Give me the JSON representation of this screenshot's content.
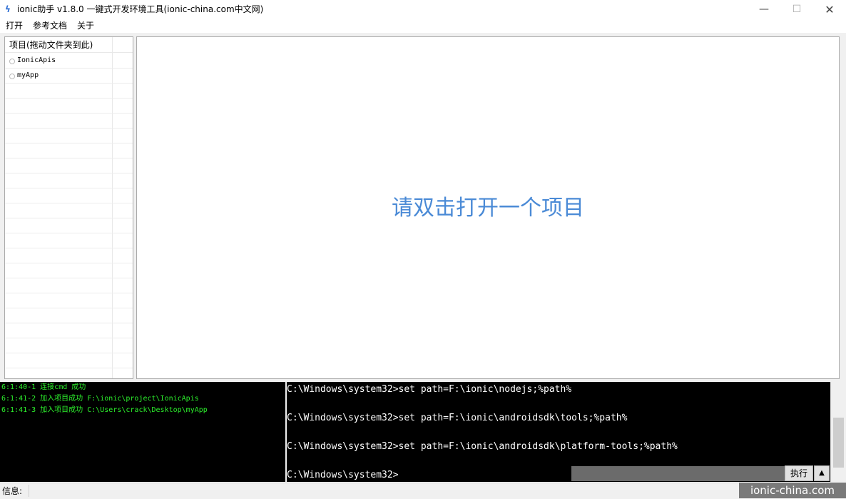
{
  "window": {
    "title": "ionic助手 v1.8.0 一键式开发环境工具(ionic-china.com中文网)",
    "icon": "lightning-icon",
    "controls": {
      "minimize": "—",
      "maximize": "☐",
      "close": "✕"
    }
  },
  "menu": {
    "items": [
      "打开",
      "参考文档",
      "关于"
    ]
  },
  "projects": {
    "header": "项目(拖动文件夹到此)",
    "items": [
      {
        "label": "IonicApis"
      },
      {
        "label": "myApp"
      }
    ]
  },
  "main": {
    "hint": "请双击打开一个项目",
    "hint_color": "#4a8ad6"
  },
  "log": {
    "color": "#2cf02c",
    "lines": [
      "6:1:40-1 连接cmd 成功",
      "6:1:41-2 加入项目成功 F:\\ionic\\project\\IonicApis",
      "6:1:41-3 加入项目成功 C:\\Users\\crack\\Desktop\\myApp"
    ]
  },
  "console": {
    "lines": [
      "C:\\Windows\\system32>set path=F:\\ionic\\nodejs;%path%",
      "",
      "C:\\Windows\\system32>set path=F:\\ionic\\androidsdk\\tools;%path%",
      "",
      "C:\\Windows\\system32>set path=F:\\ionic\\androidsdk\\platform-tools;%path%",
      "",
      "C:\\Windows\\system32>"
    ],
    "input_value": "",
    "execute_label": "执行",
    "up_label": "▲"
  },
  "status": {
    "label": "信息:",
    "value": ""
  },
  "watermark": "ionic-china.com"
}
